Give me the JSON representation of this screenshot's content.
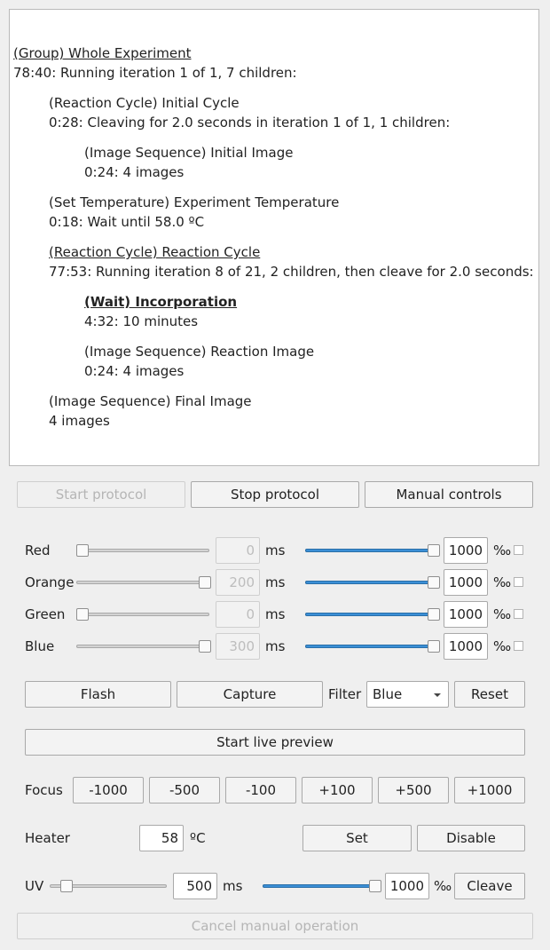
{
  "log": {
    "entries": [
      {
        "title": "(Group) Whole Experiment",
        "status": "78:40: Running iteration 1 of 1, 7 children:"
      },
      {
        "title": "(Reaction Cycle) Initial Cycle",
        "status": "0:28: Cleaving for 2.0 seconds in iteration 1 of 1, 1 children:"
      },
      {
        "title": "(Image Sequence) Initial Image",
        "status": "0:24: 4 images"
      },
      {
        "title": "(Set Temperature) Experiment Temperature",
        "status": "0:18: Wait until 58.0 ºC"
      },
      {
        "title": "(Reaction Cycle) Reaction Cycle",
        "status": "77:53: Running iteration 8 of 21, 2 children, then cleave for 2.0 seconds:"
      },
      {
        "title": "(Wait) Incorporation",
        "status": "4:32: 10 minutes"
      },
      {
        "title": "(Image Sequence) Reaction Image",
        "status": "0:24: 4 images"
      },
      {
        "title": "(Image Sequence) Final Image",
        "status": "4 images"
      }
    ]
  },
  "protocol": {
    "start": "Start protocol",
    "stop": "Stop protocol",
    "manual": "Manual controls"
  },
  "channels": [
    {
      "name": "Red",
      "exposure_ms": "0",
      "exposure_level": 0.0,
      "intensity": "1000",
      "intensity_level": 1.0
    },
    {
      "name": "Orange",
      "exposure_ms": "200",
      "exposure_level": 1.0,
      "intensity": "1000",
      "intensity_level": 1.0
    },
    {
      "name": "Green",
      "exposure_ms": "0",
      "exposure_level": 0.0,
      "intensity": "1000",
      "intensity_level": 1.0
    },
    {
      "name": "Blue",
      "exposure_ms": "300",
      "exposure_level": 1.0,
      "intensity": "1000",
      "intensity_level": 1.0
    }
  ],
  "units": {
    "ms": "ms",
    "permille": "‰",
    "celsius": "ºC"
  },
  "imaging": {
    "flash": "Flash",
    "capture": "Capture",
    "filter_label": "Filter",
    "filter_value": "Blue",
    "reset": "Reset",
    "live_preview": "Start live preview"
  },
  "focus": {
    "label": "Focus",
    "steps": [
      "-1000",
      "-500",
      "-100",
      "+100",
      "+500",
      "+1000"
    ]
  },
  "heater": {
    "label": "Heater",
    "value": "58",
    "set": "Set",
    "disable": "Disable"
  },
  "uv": {
    "label": "UV",
    "exposure_ms": "500",
    "exposure_level": 0.1,
    "intensity": "1000",
    "intensity_level": 1.0,
    "cleave": "Cleave"
  },
  "cancel": "Cancel manual operation",
  "colors": {
    "accent": "#3b8fd6"
  }
}
